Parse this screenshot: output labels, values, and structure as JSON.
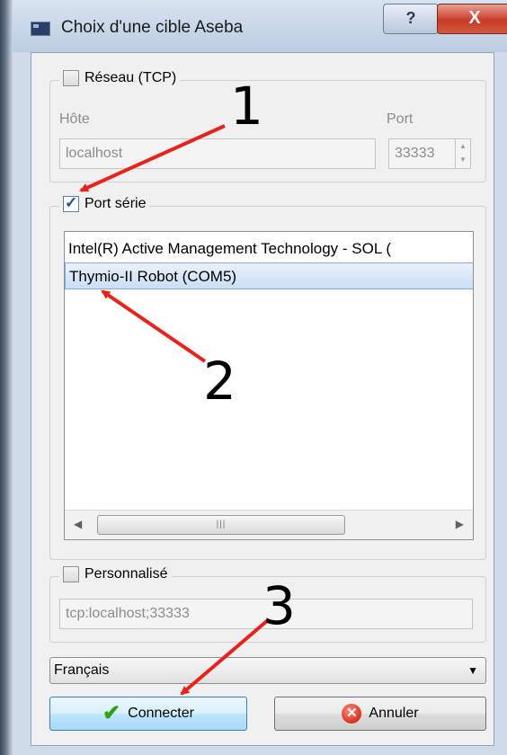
{
  "window": {
    "title": "Choix d'une cible Aseba",
    "help_label": "?",
    "close_label": "X"
  },
  "network": {
    "label": "Réseau (TCP)",
    "checked": false,
    "host_label": "Hôte",
    "port_label": "Port",
    "host_value": "localhost",
    "port_value": "33333"
  },
  "serial": {
    "label": "Port série",
    "checked": true,
    "items": [
      {
        "label": "Intel(R) Active Management Technology - SOL (",
        "selected": false
      },
      {
        "label": "Thymio-II Robot (COM5)",
        "selected": true
      }
    ],
    "scroll_left": "◀",
    "scroll_right": "▶",
    "scroll_grip": "|||"
  },
  "custom": {
    "label": "Personnalisé",
    "checked": false,
    "value": "tcp:localhost;33333"
  },
  "language": {
    "selected": "Français",
    "arrow": "▼"
  },
  "buttons": {
    "connect_label": "Connecter",
    "cancel_label": "Annuler"
  },
  "annotations": {
    "one": "1",
    "two": "2",
    "three": "3",
    "color": "#e8231c"
  }
}
